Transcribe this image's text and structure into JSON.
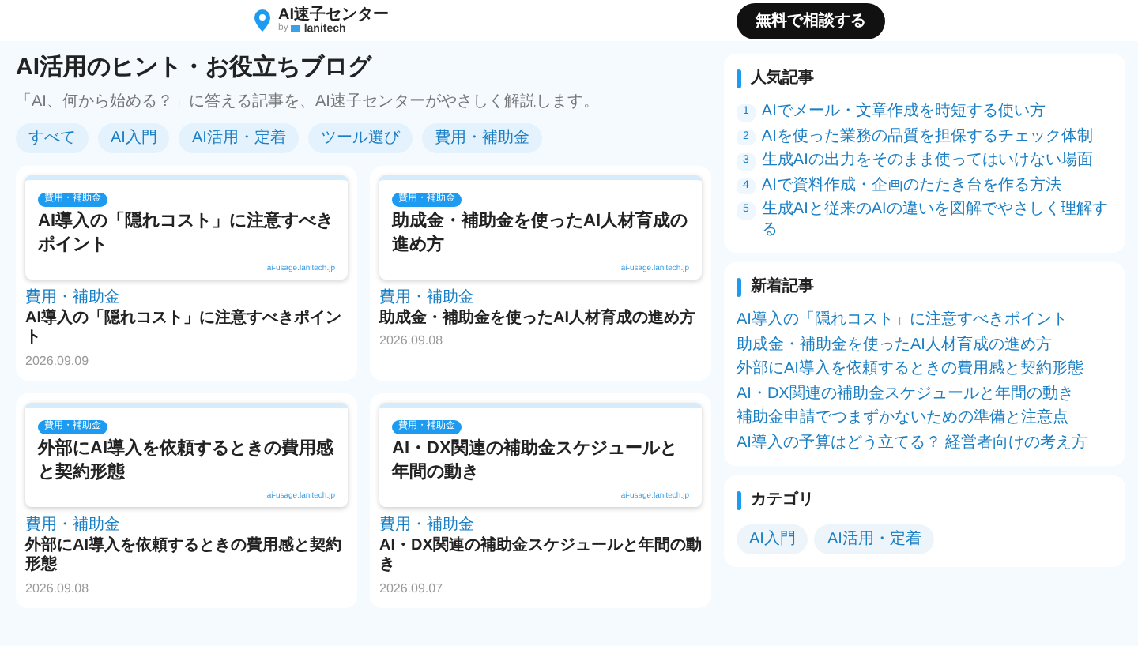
{
  "header": {
    "logo_name": "AI速子センター",
    "logo_by": "by",
    "logo_company": "lanitech",
    "cta": "無料で相談する"
  },
  "hero": {
    "title": "AI活用のヒント・お役立ちブログ",
    "subtitle": "「AI、何から始める？」に答える記事を、AI速子センターがやさしく解説します。",
    "tags": [
      "すべて",
      "AI入門",
      "AI活用・定着",
      "ツール選び",
      "費用・補助金"
    ]
  },
  "articles": [
    {
      "thumb_badge": "費用・補助金",
      "thumb_title": "AI導入の「隠れコスト」に注意すべきポイント",
      "thumb_url": "ai-usage.lanitech.jp",
      "category": "費用・補助金",
      "title": "AI導入の「隠れコスト」に注意すべきポイント",
      "date": "2026.09.09"
    },
    {
      "thumb_badge": "費用・補助金",
      "thumb_title": "助成金・補助金を使ったAI人材育成の進め方",
      "thumb_url": "ai-usage.lanitech.jp",
      "category": "費用・補助金",
      "title": "助成金・補助金を使ったAI人材育成の進め方",
      "date": "2026.09.08"
    },
    {
      "thumb_badge": "費用・補助金",
      "thumb_title": "外部にAI導入を依頼するときの費用感と契約形態",
      "thumb_url": "ai-usage.lanitech.jp",
      "category": "費用・補助金",
      "title": "外部にAI導入を依頼するときの費用感と契約形態",
      "date": "2026.09.08"
    },
    {
      "thumb_badge": "費用・補助金",
      "thumb_title": "AI・DX関連の補助金スケジュールと年間の動き",
      "thumb_url": "ai-usage.lanitech.jp",
      "category": "費用・補助金",
      "title": "AI・DX関連の補助金スケジュールと年間の動き",
      "date": "2026.09.07"
    }
  ],
  "popular": {
    "heading": "人気記事",
    "items": [
      {
        "rank": "1",
        "title": "AIでメール・文章作成を時短する使い方"
      },
      {
        "rank": "2",
        "title": "AIを使った業務の品質を担保するチェック体制"
      },
      {
        "rank": "3",
        "title": "生成AIの出力をそのまま使ってはいけない場面"
      },
      {
        "rank": "4",
        "title": "AIで資料作成・企画のたたき台を作る方法"
      },
      {
        "rank": "5",
        "title": "生成AIと従来のAIの違いを図解でやさしく理解する"
      }
    ]
  },
  "recent": {
    "heading": "新着記事",
    "items": [
      "AI導入の「隠れコスト」に注意すべきポイント",
      "助成金・補助金を使ったAI人材育成の進め方",
      "外部にAI導入を依頼するときの費用感と契約形態",
      "AI・DX関連の補助金スケジュールと年間の動き",
      "補助金申請でつまずかないための準備と注意点",
      "AI導入の予算はどう立てる？ 経営者向けの考え方"
    ]
  },
  "categories": {
    "heading": "カテゴリ",
    "items": [
      "AI入門",
      "AI活用・定着"
    ]
  }
}
